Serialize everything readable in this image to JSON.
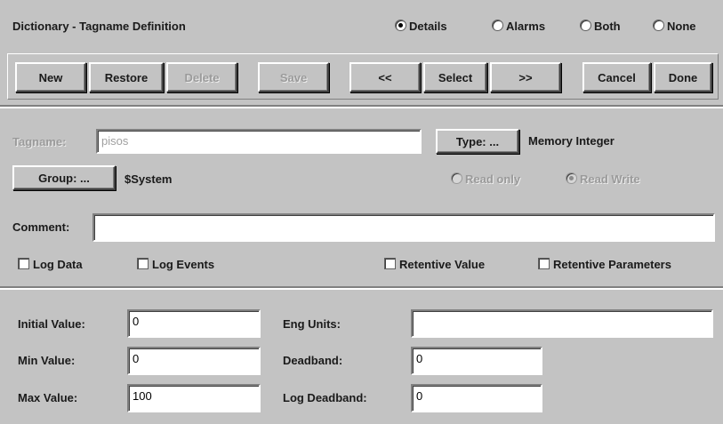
{
  "window": {
    "title": "Dictionary - Tagname Definition"
  },
  "view_options": [
    {
      "label": "Details",
      "selected": true
    },
    {
      "label": "Alarms",
      "selected": false
    },
    {
      "label": "Both",
      "selected": false
    },
    {
      "label": "None",
      "selected": false
    }
  ],
  "toolbar": {
    "new": "New",
    "restore": "Restore",
    "delete": "Delete",
    "save": "Save",
    "prev": "<<",
    "select": "Select",
    "next": ">>",
    "cancel": "Cancel",
    "done": "Done"
  },
  "tag": {
    "tagname_label": "Tagname:",
    "tagname_value": "pisos",
    "type_button": "Type: ...",
    "type_value": "Memory Integer",
    "group_button": "Group: ...",
    "group_value": "$System",
    "access_options": [
      {
        "label": "Read only",
        "selected": false
      },
      {
        "label": "Read Write",
        "selected": true
      }
    ],
    "comment_label": "Comment:",
    "comment_value": "",
    "checks": {
      "log_data": "Log Data",
      "log_events": "Log Events",
      "retentive_value": "Retentive Value",
      "retentive_parameters": "Retentive Parameters"
    }
  },
  "values": {
    "initial_label": "Initial Value:",
    "initial_value": "0",
    "min_label": "Min Value:",
    "min_value": "0",
    "max_label": "Max Value:",
    "max_value": "100",
    "eng_units_label": "Eng Units:",
    "eng_units_value": "",
    "deadband_label": "Deadband:",
    "deadband_value": "0",
    "log_deadband_label": "Log Deadband:",
    "log_deadband_value": "0"
  }
}
